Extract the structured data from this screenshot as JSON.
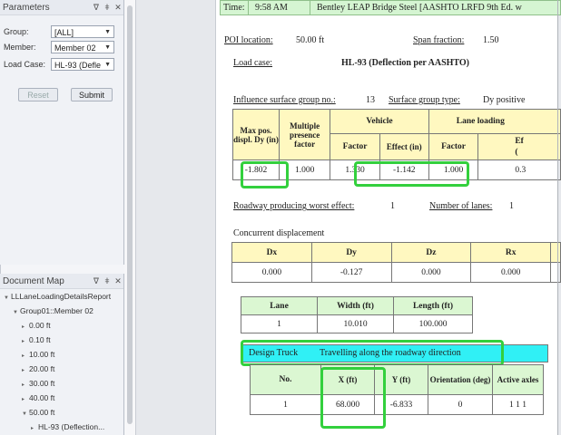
{
  "parameters": {
    "title": "Parameters",
    "group_label": "Group:",
    "group_value": "[ALL]",
    "member_label": "Member:",
    "member_value": "Member 02",
    "loadcase_label": "Load Case:",
    "loadcase_value": "HL-93 (Defle",
    "reset_label": "Reset",
    "submit_label": "Submit"
  },
  "docmap": {
    "title": "Document Map",
    "items": [
      "LLLaneLoadingDetailsReport",
      "Group01::Member 02",
      "0.00 ft",
      "0.10 ft",
      "10.00 ft",
      "20.00 ft",
      "30.00 ft",
      "40.00 ft",
      "50.00 ft",
      "HL-93 (Deflection..."
    ]
  },
  "pane_controls": {
    "pin": "ᐁ",
    "dock": "ǂ",
    "close": "✕"
  },
  "report": {
    "time_label": "Time:",
    "time_value": "9:58 AM",
    "program": "Bentley LEAP Bridge Steel [AASHTO LRFD 9th Ed. w",
    "poi_label": "POI location:",
    "poi_value": "50.00 ft",
    "span_label": "Span fraction:",
    "span_value": "1.50",
    "load_case_label": "Load case:",
    "load_case_value": "HL-93 (Deflection per AASHTO)",
    "isg_label": "Influence surface group no.:",
    "isg_value": "13",
    "sgt_label": "Surface group type:",
    "sgt_value": "Dy positive",
    "main_table": {
      "col_max": "Max pos. displ. Dy (in)",
      "col_mpf": "Multiple presence factor",
      "col_vehicle": "Vehicle",
      "col_lane": "Lane loading",
      "sub_factor": "Factor",
      "sub_effect": "Effect (in)",
      "sub_lfactor": "Factor",
      "sub_leffect": "Ef",
      "sub_leffect2": "(",
      "row": [
        "-1.802",
        "1.000",
        "1.330",
        "-1.142",
        "1.000",
        "0.3"
      ]
    },
    "roadway_label": "Roadway producing worst effect:",
    "roadway_value": "1",
    "lanes_label": "Number of lanes:",
    "lanes_value": "1",
    "concurrent_title": "Concurrent displacement",
    "concurrent": {
      "headers": [
        "Dx",
        "Dy",
        "Dz",
        "Rx"
      ],
      "values": [
        "0.000",
        "-0.127",
        "0.000",
        "0.000"
      ]
    },
    "lane_table": {
      "headers": [
        "Lane",
        "Width (ft)",
        "Length (ft)"
      ],
      "row": [
        "1",
        "10.010",
        "100.000"
      ]
    },
    "design_truck_label": "Design Truck",
    "design_truck_desc": "Travelling along the roadway direction",
    "truck_table": {
      "headers": [
        "No.",
        "X (ft)",
        "Y (ft)",
        "Orientation (deg)",
        "Active axles"
      ],
      "row": [
        "1",
        "68.000",
        "-6.833",
        "0",
        "1 1 1"
      ]
    }
  }
}
